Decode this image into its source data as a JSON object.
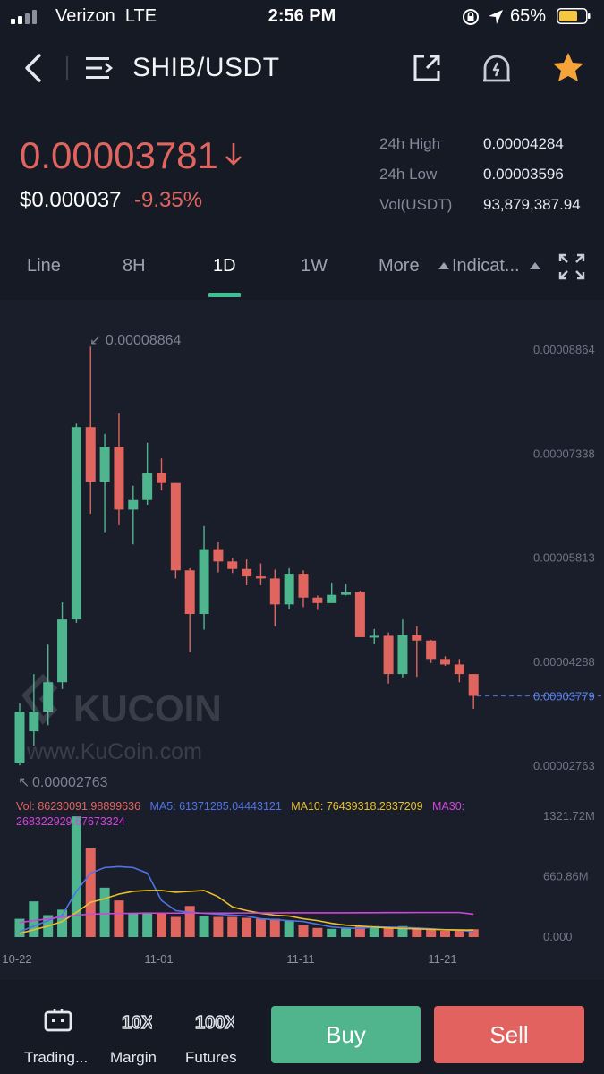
{
  "status": {
    "carrier": "Verizon",
    "network": "LTE",
    "time": "2:56 PM",
    "battery_pct": "65%"
  },
  "nav": {
    "title": "SHIB/USDT",
    "icons": [
      "back-chevron-icon",
      "menu-list-icon",
      "share-icon",
      "price-alert-icon",
      "favorite-star-icon"
    ]
  },
  "ticker": {
    "last_price": "0.00003781",
    "usd_price": "$0.000037",
    "change": "-9.35%",
    "stats": [
      {
        "label": "24h High",
        "value": "0.00004284"
      },
      {
        "label": "24h Low",
        "value": "0.00003596"
      },
      {
        "label": "Vol(USDT)",
        "value": "93,879,387.94"
      }
    ]
  },
  "tabs": {
    "items": [
      "Line",
      "8H",
      "1D",
      "1W",
      "More",
      "Indicat..."
    ],
    "active": "1D"
  },
  "chart": {
    "watermark_brand": "KUCOIN",
    "watermark_url": "www.KuCoin.com",
    "high_marker": "0.00008864",
    "low_marker": "0.00002763",
    "current_price_label": "0.00003779",
    "price_ticks": [
      "0.00008864",
      "0.00007338",
      "0.00005813",
      "0.00004288",
      "0.00002763"
    ],
    "volume_ticks": [
      "1321.72M",
      "660.86M",
      "0.000"
    ],
    "date_ticks": [
      "10-22",
      "11-01",
      "11-11",
      "11-21"
    ],
    "vol_legend": {
      "vol": "Vol: 86230091.98899636",
      "ma5": "MA5: 61371285.04443121",
      "ma10": "MA10: 76439318.2837209",
      "ma30": "MA30: 268322929.67673324"
    },
    "colors": {
      "up": "#4fb58e",
      "down": "#e0655f",
      "ma5": "#4f74e5",
      "ma10": "#e8c02c",
      "ma30": "#cf46d9"
    }
  },
  "chart_data": {
    "type": "candlestick",
    "price_axis": {
      "min": 2.763e-05,
      "max": 8.864e-05
    },
    "volume_axis": {
      "min": 0,
      "max": 1321.72,
      "unit": "M"
    },
    "x_labels": [
      {
        "index": 0,
        "label": "10-22"
      },
      {
        "index": 10,
        "label": "11-01"
      },
      {
        "index": 20,
        "label": "11-11"
      },
      {
        "index": 30,
        "label": "11-21"
      }
    ],
    "candles": [
      {
        "o": 2.79,
        "c": 3.55,
        "h": 3.67,
        "l": 2.76
      },
      {
        "o": 3.26,
        "c": 3.55,
        "h": 4.1,
        "l": 3.05
      },
      {
        "o": 3.55,
        "c": 3.98,
        "h": 4.53,
        "l": 3.35
      },
      {
        "o": 3.98,
        "c": 4.9,
        "h": 5.15,
        "l": 3.88
      },
      {
        "o": 4.9,
        "c": 7.72,
        "h": 7.77,
        "l": 4.85
      },
      {
        "o": 7.72,
        "c": 6.92,
        "h": 8.9,
        "l": 6.45
      },
      {
        "o": 6.92,
        "c": 7.43,
        "h": 7.62,
        "l": 6.18
      },
      {
        "o": 7.43,
        "c": 6.51,
        "h": 7.92,
        "l": 6.28
      },
      {
        "o": 6.51,
        "c": 6.65,
        "h": 6.86,
        "l": 6.0
      },
      {
        "o": 6.65,
        "c": 7.05,
        "h": 7.49,
        "l": 6.58
      },
      {
        "o": 7.05,
        "c": 6.9,
        "h": 7.26,
        "l": 6.79
      },
      {
        "o": 6.9,
        "c": 5.62,
        "h": 6.9,
        "l": 5.5
      },
      {
        "o": 5.62,
        "c": 4.98,
        "h": 5.65,
        "l": 4.42
      },
      {
        "o": 4.98,
        "c": 5.93,
        "h": 6.27,
        "l": 4.75
      },
      {
        "o": 5.93,
        "c": 5.75,
        "h": 6.03,
        "l": 5.59
      },
      {
        "o": 5.75,
        "c": 5.64,
        "h": 5.8,
        "l": 5.58
      },
      {
        "o": 5.64,
        "c": 5.53,
        "h": 5.78,
        "l": 5.4
      },
      {
        "o": 5.53,
        "c": 5.5,
        "h": 5.72,
        "l": 5.4
      },
      {
        "o": 5.5,
        "c": 5.12,
        "h": 5.63,
        "l": 4.8
      },
      {
        "o": 5.12,
        "c": 5.57,
        "h": 5.65,
        "l": 5.05
      },
      {
        "o": 5.57,
        "c": 5.22,
        "h": 5.62,
        "l": 5.08
      },
      {
        "o": 5.22,
        "c": 5.14,
        "h": 5.25,
        "l": 5.04
      },
      {
        "o": 5.14,
        "c": 5.26,
        "h": 5.44,
        "l": 5.14
      },
      {
        "o": 5.26,
        "c": 5.3,
        "h": 5.42,
        "l": 5.25
      },
      {
        "o": 5.3,
        "c": 4.64,
        "h": 5.32,
        "l": 4.64
      },
      {
        "o": 4.64,
        "c": 4.66,
        "h": 4.76,
        "l": 4.54
      },
      {
        "o": 4.66,
        "c": 4.1,
        "h": 4.71,
        "l": 3.96
      },
      {
        "o": 4.1,
        "c": 4.67,
        "h": 4.9,
        "l": 4.05
      },
      {
        "o": 4.67,
        "c": 4.59,
        "h": 4.8,
        "l": 4.06
      },
      {
        "o": 4.59,
        "c": 4.32,
        "h": 4.6,
        "l": 4.26
      },
      {
        "o": 4.32,
        "c": 4.24,
        "h": 4.36,
        "l": 4.22
      },
      {
        "o": 4.24,
        "c": 4.1,
        "h": 4.32,
        "l": 3.98
      },
      {
        "o": 4.1,
        "c": 3.78,
        "h": 4.1,
        "l": 3.59
      }
    ],
    "candle_scale_note": "o/c/h/l in units of 1e-5 USDT",
    "volume_M": [
      200,
      390,
      240,
      300,
      1320,
      970,
      540,
      400,
      260,
      270,
      260,
      220,
      340,
      230,
      220,
      220,
      210,
      200,
      200,
      180,
      130,
      100,
      90,
      95,
      120,
      120,
      110,
      120,
      100,
      90,
      70,
      85,
      86
    ],
    "ma5_M": [
      60,
      120,
      180,
      240,
      500,
      700,
      760,
      770,
      760,
      700,
      400,
      290,
      270,
      260,
      250,
      240,
      230,
      200,
      190,
      180,
      170,
      140,
      110,
      100,
      95,
      110,
      110,
      105,
      100,
      90,
      80,
      75,
      61
    ],
    "ma10_M": [
      40,
      80,
      120,
      170,
      270,
      380,
      420,
      470,
      500,
      510,
      510,
      490,
      500,
      510,
      440,
      330,
      290,
      260,
      240,
      230,
      200,
      180,
      150,
      130,
      120,
      110,
      100,
      95,
      90,
      85,
      80,
      78,
      76
    ],
    "ma30_M": [
      160,
      180,
      200,
      220,
      240,
      250,
      255,
      258,
      260,
      262,
      262,
      262,
      262,
      262,
      262,
      262,
      263,
      264,
      264,
      265,
      265,
      265,
      265,
      265,
      266,
      266,
      267,
      267,
      268,
      268,
      268,
      268,
      250
    ]
  }
}
